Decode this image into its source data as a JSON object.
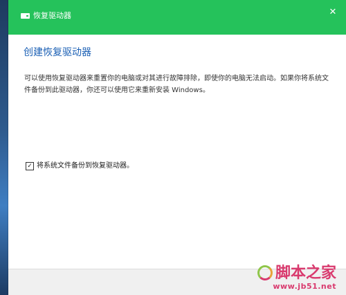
{
  "window": {
    "title": "恢复驱动器",
    "icon": "drive-icon",
    "close_glyph": "✕"
  },
  "main": {
    "heading": "创建恢复驱动器",
    "description": "可以使用恢复驱动器来重置你的电脑或对其进行故障排除，即使你的电脑无法启动。如果你将系统文件备份到此驱动器，你还可以使用它来重新安装 Windows。",
    "checkbox": {
      "label": "将系统文件备份到恢复驱动器。",
      "checked": true,
      "glyph": "✓"
    }
  },
  "watermark": {
    "text": "脚本之家",
    "url": "www.jb51.net"
  },
  "colors": {
    "titlebar": "#25c25b",
    "heading": "#1a5fb4",
    "watermark": "#d93a6e"
  }
}
